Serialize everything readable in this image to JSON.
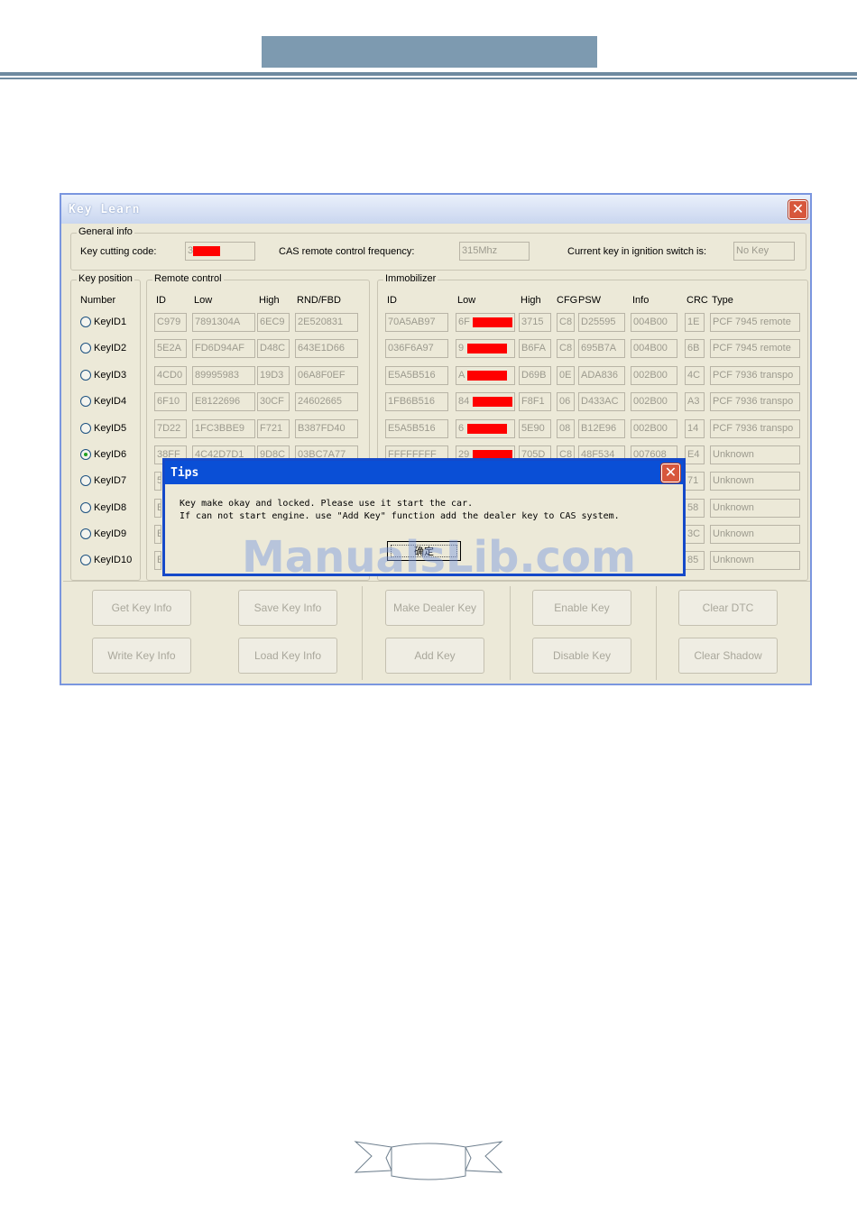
{
  "dialog": {
    "title": "Key Learn",
    "general_info": {
      "group_label": "General info",
      "key_cutting_code_label": "Key cutting code:",
      "key_cutting_code_value": "3",
      "cas_freq_label": "CAS remote control frequency:",
      "cas_freq_value": "315Mhz",
      "current_key_label": "Current key in ignition switch is:",
      "current_key_value": "No Key"
    },
    "key_position": {
      "group_label": "Key position",
      "number_header": "Number",
      "selected": "KeyID6",
      "keys": [
        "KeyID1",
        "KeyID2",
        "KeyID3",
        "KeyID4",
        "KeyID5",
        "KeyID6",
        "KeyID7",
        "KeyID8",
        "KeyID9",
        "KeyID10"
      ]
    },
    "remote_control": {
      "group_label": "Remote control",
      "headers": [
        "ID",
        "Low",
        "High",
        "RND/FBD"
      ],
      "rows": [
        [
          "C979",
          "7891304A",
          "6EC9",
          "2E520831"
        ],
        [
          "5E2A",
          "FD6D94AF",
          "D48C",
          "643E1D66"
        ],
        [
          "4CD0",
          "89995983",
          "19D3",
          "06A8F0EF"
        ],
        [
          "6F10",
          "E8122696",
          "30CF",
          "24602665"
        ],
        [
          "7D22",
          "1FC3BBE9",
          "F721",
          "B387FD40"
        ],
        [
          "38FF",
          "4C42D7D1",
          "9D8C",
          "03BC7A77"
        ],
        [
          "5",
          "",
          "",
          ""
        ],
        [
          "E",
          "",
          "",
          ""
        ],
        [
          "E",
          "",
          "",
          ""
        ],
        [
          "E",
          "",
          "",
          ""
        ]
      ]
    },
    "immobilizer": {
      "group_label": "Immobilizer",
      "headers": [
        "ID",
        "Low",
        "High",
        "CFG",
        "PSW",
        "Info",
        "CRC",
        "Type"
      ],
      "rows": [
        [
          "70A5AB97",
          "6F",
          "3715",
          "C8",
          "D25595",
          "004B00",
          "1E",
          "PCF 7945 remote"
        ],
        [
          "036F6A97",
          "9",
          "B6FA",
          "C8",
          "695B7A",
          "004B00",
          "6B",
          "PCF 7945 remote"
        ],
        [
          "E5A5B516",
          "A",
          "D69B",
          "0E",
          "ADA836",
          "002B00",
          "4C",
          "PCF 7936 transpo"
        ],
        [
          "1FB6B516",
          "84",
          "F8F1",
          "06",
          "D433AC",
          "002B00",
          "A3",
          "PCF 7936 transpo"
        ],
        [
          "E5A5B516",
          "6",
          "5E90",
          "08",
          "B12E96",
          "002B00",
          "14",
          "PCF 7936 transpo"
        ],
        [
          "FFFFFFFF",
          "29",
          "705D",
          "C8",
          "48F534",
          "007608",
          "E4",
          "Unknown"
        ],
        [
          "",
          "",
          "",
          "",
          "",
          "",
          "71",
          "Unknown"
        ],
        [
          "",
          "",
          "",
          "",
          "",
          "",
          "58",
          "Unknown"
        ],
        [
          "",
          "",
          "",
          "",
          "",
          "",
          "3C",
          "Unknown"
        ],
        [
          "",
          "",
          "",
          "",
          "",
          "",
          "85",
          "Unknown"
        ]
      ]
    },
    "buttons": {
      "get_key_info": "Get Key Info",
      "write_key_info": "Write Key Info",
      "save_key_info": "Save Key Info",
      "load_key_info": "Load Key Info",
      "make_dealer_key": "Make Dealer Key",
      "add_key": "Add Key",
      "enable_key": "Enable Key",
      "disable_key": "Disable Key",
      "clear_dtc": "Clear DTC",
      "clear_shadow": "Clear Shadow"
    }
  },
  "tips": {
    "title": "Tips",
    "line1": "Key make okay and locked. Please use it start the car.",
    "line2": "If can not start engine. use \"Add Key\" function add the dealer key to CAS system.",
    "ok_label": "确定"
  },
  "watermark": "ManualsLib.com",
  "colors": {
    "title_bar_blue": "#0a4fd6",
    "window_bg": "#ece9d8",
    "redaction": "#ff0000"
  }
}
